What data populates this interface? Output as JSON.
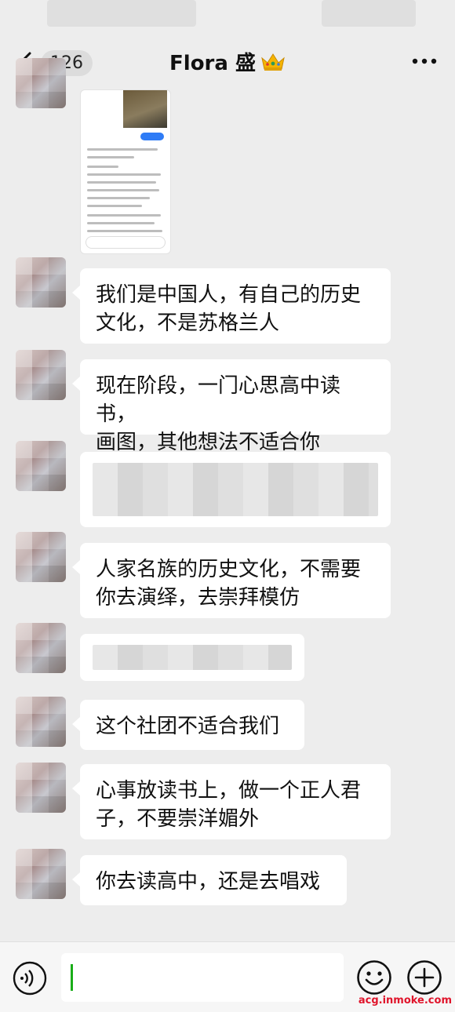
{
  "header": {
    "back_count": "126",
    "title": "Flora 盛"
  },
  "messages": [
    {
      "type": "image"
    },
    {
      "type": "text",
      "text": "我们是中国人，有自己的历史\n文化，不是苏格兰人"
    },
    {
      "type": "text",
      "text": "现在阶段，一门心思高中读书，\n画图，其他想法不适合你"
    },
    {
      "type": "redacted"
    },
    {
      "type": "text",
      "text": "人家名族的历史文化，不需要\n你去演绎，去崇拜模仿"
    },
    {
      "type": "redacted"
    },
    {
      "type": "text",
      "text": "这个社团不适合我们"
    },
    {
      "type": "text",
      "text": "心事放读书上，做一个正人君\n子，不要崇洋媚外"
    },
    {
      "type": "text",
      "text": "你去读高中，还是去唱戏"
    }
  ],
  "input": {
    "value": ""
  },
  "icons": {
    "back": "chevron-left-icon",
    "crown": "crown-emoji",
    "more": "more-dots-icon",
    "voice": "voice-icon",
    "emoji": "emoji-icon",
    "plus": "plus-icon"
  },
  "colors": {
    "background": "#ededed",
    "bubble": "#ffffff",
    "cursor": "#1aad19",
    "watermark": "#e0142b"
  },
  "watermark": "acg.inmoke.com"
}
